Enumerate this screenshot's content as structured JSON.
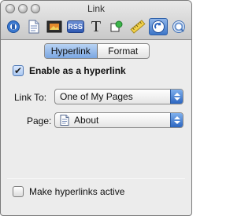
{
  "window": {
    "title": "Link"
  },
  "toolbar": {
    "items": [
      {
        "name": "metrics-icon",
        "active": false
      },
      {
        "name": "page-icon",
        "active": false
      },
      {
        "name": "media-icon",
        "active": false
      },
      {
        "name": "rss-icon",
        "label": "RSS",
        "active": false
      },
      {
        "name": "text-icon",
        "label": "T",
        "active": false
      },
      {
        "name": "graphic-icon",
        "active": false
      },
      {
        "name": "ruler-icon",
        "active": false
      },
      {
        "name": "link-icon",
        "active": true
      },
      {
        "name": "quicktime-icon",
        "active": false
      }
    ]
  },
  "tabs": {
    "items": [
      {
        "label": "Hyperlink",
        "selected": true
      },
      {
        "label": "Format",
        "selected": false
      }
    ]
  },
  "form": {
    "enable_hyperlink": {
      "label": "Enable as a hyperlink",
      "checked": true
    },
    "link_to": {
      "label": "Link To:",
      "value": "One of My Pages"
    },
    "page": {
      "label": "Page:",
      "value": "About"
    },
    "make_active": {
      "label": "Make hyperlinks active",
      "checked": false
    }
  },
  "colors": {
    "accent": "#3d76c8",
    "window_bg": "#ececec"
  }
}
